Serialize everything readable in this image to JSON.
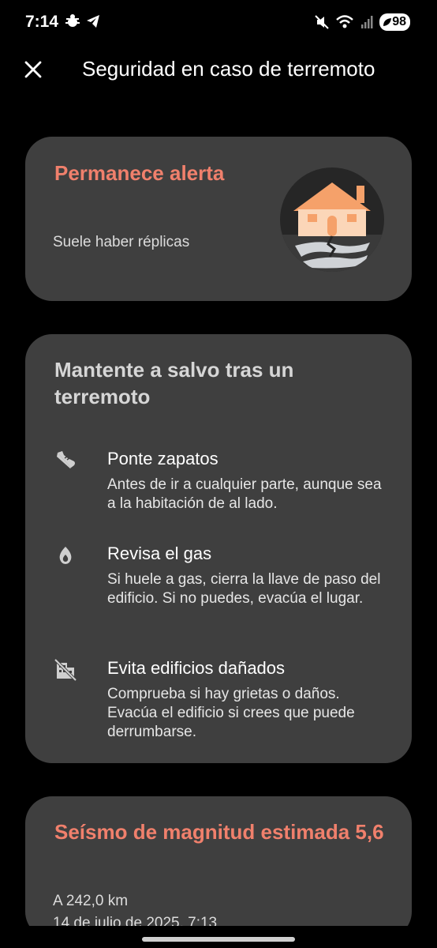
{
  "status": {
    "time": "7:14",
    "battery": "98"
  },
  "appbar": {
    "title": "Seguridad en caso de terremoto"
  },
  "alert_card": {
    "title": "Permanece alerta",
    "subtitle": "Suele haber réplicas"
  },
  "safety_card": {
    "title": "Mantente a salvo tras un terremoto",
    "tips": [
      {
        "icon": "shoe-icon",
        "title": "Ponte zapatos",
        "text": "Antes de ir a cualquier parte, aunque sea a la habitación de al lado."
      },
      {
        "icon": "gas-flame-icon",
        "title": "Revisa el gas",
        "text": "Si huele a gas, cierra la llave de paso del edificio. Si no puedes, evacúa el lugar."
      },
      {
        "icon": "damaged-building-icon",
        "title": "Evita edificios dañados",
        "text": "Comprueba si hay grietas o daños. Evacúa el edificio si crees que puede derrumbarse."
      }
    ]
  },
  "quake_card": {
    "title": "Seísmo de magnitud estimada 5,6",
    "distance": "A 242,0 km",
    "date": "14 de julio de 2025, 7:13"
  },
  "colors": {
    "accent": "#f0806c",
    "card_bg": "#3f3f3f",
    "background": "#000000"
  }
}
